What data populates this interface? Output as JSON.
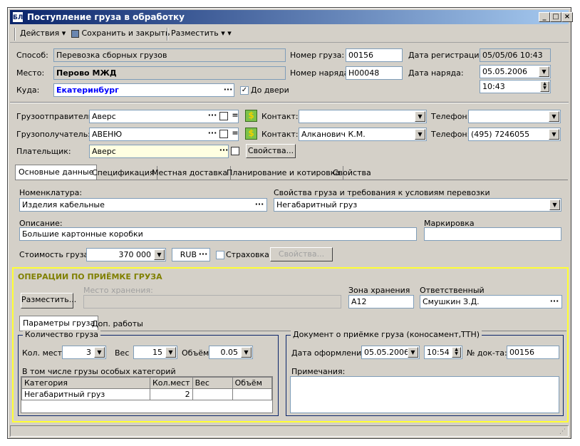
{
  "window": {
    "title": "Поступление груза в обработку",
    "app_icon_text": "БЛ"
  },
  "toolbar": {
    "actions": "Действия",
    "save_close": "Сохранить и закрыть",
    "place": "Разместить"
  },
  "header": {
    "method_label": "Способ:",
    "method_value": "Перевозка сборных грузов",
    "place_label": "Место:",
    "place_value": "Перово МЖД",
    "dest_label": "Куда:",
    "dest_value": "Екатеринбург",
    "door_label": "До двери",
    "door_checked": true,
    "cargo_no_label": "Номер груза:",
    "cargo_no": "00156",
    "order_no_label": "Номер наряда:",
    "order_no": "Н00048",
    "reg_date_label": "Дата регистрации:",
    "reg_date": "05/05/06 10:43",
    "order_date_label": "Дата наряда:",
    "order_date": "05.05.2006",
    "order_time": "10:43"
  },
  "parties": {
    "sender_label": "Грузоотправитель:",
    "sender": "Аверс",
    "receiver_label": "Грузополучатель:",
    "receiver": "АВЕНЮ",
    "payer_label": "Плательщик:",
    "payer": "Аверс",
    "contact_label": "Контакт:",
    "sender_contact": "",
    "receiver_contact": "Алканович К.М.",
    "phone_label": "Телефон:",
    "sender_phone": "",
    "receiver_phone": "(495) 7246055",
    "props_button": "Свойства..."
  },
  "tabs": [
    "Основные данные",
    "Спецификация",
    "Местная доставка",
    "Планирование и котировка",
    "Свойства"
  ],
  "main": {
    "nomen_label": "Номенклатура:",
    "nomen_value": "Изделия кабельные",
    "props_req_label": "Свойства груза и требования к условиям перевозки",
    "props_req_value": "Негабаритный груз",
    "desc_label": "Описание:",
    "desc_value": "Большие картонные коробки",
    "marking_label": "Маркировка",
    "marking_value": "",
    "cost_label": "Стоимость груза:",
    "cost_value": "370 000",
    "currency": "RUB",
    "insurance_label": "Страховка",
    "props_button": "Свойства..."
  },
  "ops": {
    "title": "ОПЕРАЦИИ ПО ПРИЁМКЕ ГРУЗА",
    "place_button": "Разместить...",
    "storage_place_label": "Место хранения:",
    "storage_place_value": "",
    "storage_zone_label": "Зона хранения",
    "storage_zone_value": "A12",
    "responsible_label": "Ответственный",
    "responsible_value": "Смушкин З.Д.",
    "subtabs": [
      "Параметры груза",
      "Доп. работы"
    ],
    "qty_group": "Количество груза",
    "places_label": "Кол. мест",
    "places_value": "3",
    "weight_label": "Вес",
    "weight_value": "15",
    "volume_label": "Объём",
    "volume_value": "0.05",
    "special_label": "В том числе грузы особых категорий",
    "table_headers": [
      "Категория",
      "Кол.мест",
      "Вес",
      "Объём"
    ],
    "table_rows": [
      [
        "Негабаритный груз",
        "2",
        "",
        ""
      ]
    ],
    "doc_group": "Документ о приёмке груза (коносамент,ТТН)",
    "doc_date_label": "Дата оформления:",
    "doc_date": "05.05.2006",
    "doc_time": "10:54",
    "doc_no_label": "№ док-та:",
    "doc_no": "00156",
    "notes_label": "Примечания:",
    "notes_value": ""
  },
  "colors": {
    "title_bar": "#0a246a",
    "highlight_border": "#ffff33",
    "ops_title": "#808000",
    "dest_text": "#0000ff"
  }
}
